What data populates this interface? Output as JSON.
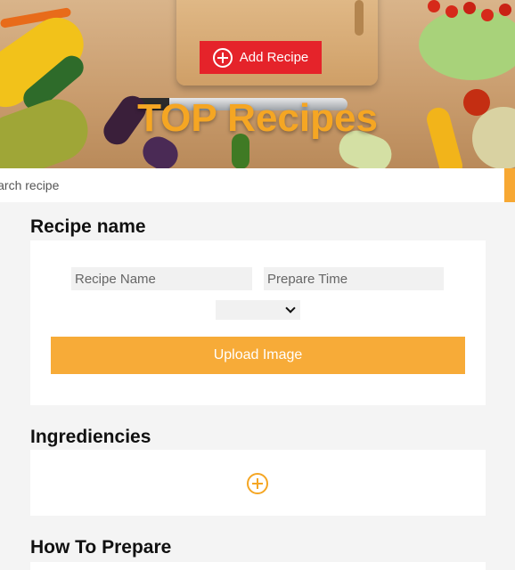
{
  "header": {
    "add_recipe_label": "Add Recipe",
    "title": "TOP Recipes"
  },
  "search": {
    "placeholder": "Search recipe"
  },
  "recipe_section": {
    "heading": "Recipe name",
    "name_placeholder": "Recipe Name",
    "time_placeholder": "Prepare Time",
    "category_selected": "",
    "upload_label": "Upload Image"
  },
  "ingredients_section": {
    "heading": "Ingrediencies"
  },
  "prepare_section": {
    "heading": "How To Prepare"
  },
  "colors": {
    "accent_orange": "#f7ab38",
    "add_button_red": "#e5232a",
    "page_background": "#f4f4f4"
  }
}
